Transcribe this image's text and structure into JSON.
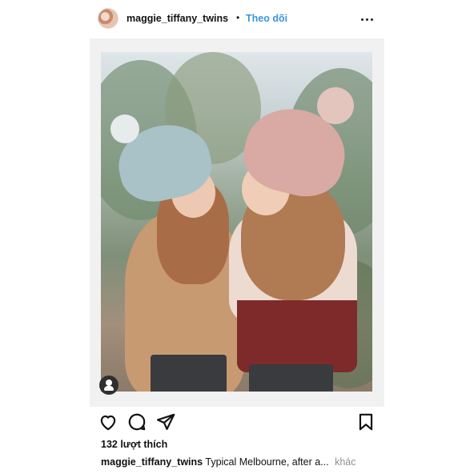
{
  "header": {
    "username": "maggie_tiffany_twins",
    "separator": "•",
    "follow_label": "Theo dõi"
  },
  "icons": {
    "avatar": "profile-avatar",
    "more": "more-horizontal-icon",
    "tag": "user-tag-icon",
    "like": "heart-icon",
    "comment": "comment-bubble-icon",
    "share": "paper-plane-icon",
    "save": "bookmark-icon"
  },
  "stats": {
    "likes": "132 lượt thích"
  },
  "caption": {
    "author": "maggie_tiffany_twins",
    "text": "Typical Melbourne, after a...",
    "more_label": "khác"
  },
  "colors": {
    "follow": "#3897d9",
    "muted": "#8e8e8e",
    "text": "#111111"
  }
}
